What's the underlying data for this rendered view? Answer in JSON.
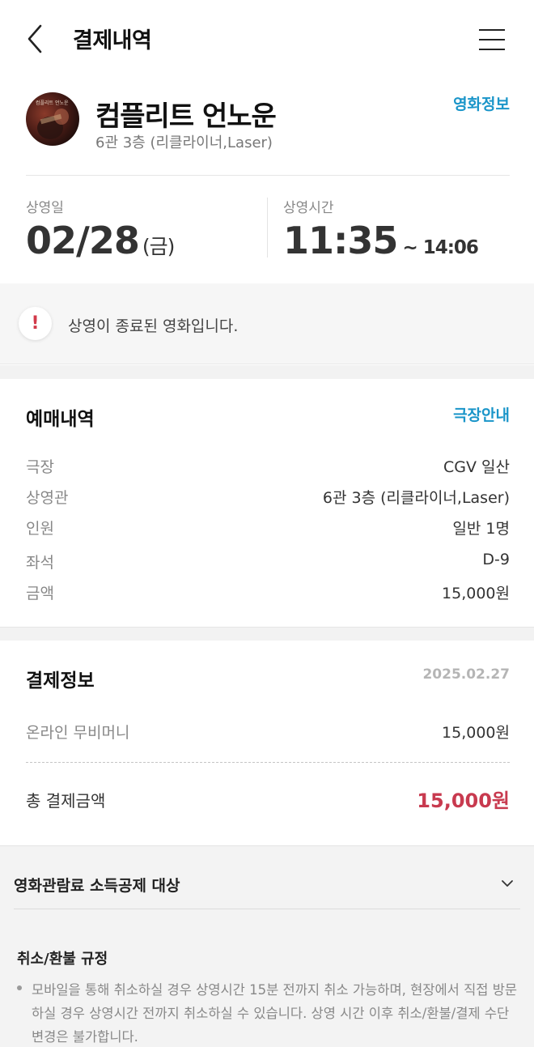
{
  "header": {
    "title": "결제내역"
  },
  "movie": {
    "title": "컴플리트 언노운",
    "screen": "6관 3층 (리클라이너,Laser)",
    "info_link": "영화정보",
    "poster_overlay": "컴플리트 언노운"
  },
  "schedule": {
    "date_label": "상영일",
    "date": "02/28",
    "day": "(금)",
    "time_label": "상영시간",
    "start": "11:35",
    "end": "~ 14:06"
  },
  "notice": {
    "icon": "!",
    "text": "상영이 종료된 영화입니다."
  },
  "booking": {
    "title": "예매내역",
    "link": "극장안내",
    "rows": [
      {
        "label": "극장",
        "value": "CGV 일산"
      },
      {
        "label": "상영관",
        "value": "6관 3층 (리클라이너,Laser)"
      },
      {
        "label": "인원",
        "value": "일반 1명"
      },
      {
        "label": "좌석",
        "value": "D-9"
      },
      {
        "label": "금액",
        "value": "15,000원"
      }
    ]
  },
  "payment": {
    "title": "결제정보",
    "date": "2025.02.27",
    "method_label": "온라인 무비머니",
    "method_value": "15,000원",
    "total_label": "총 결제금액",
    "total_value": "15,000원"
  },
  "deduction": {
    "label": "영화관람료 소득공제 대상"
  },
  "refund": {
    "title": "취소/환불 규정",
    "text": "모바일을 통해 취소하실 경우 상영시간 15분 전까지 취소 가능하며, 현장에서 직접 방문하실 경우 상영시간 전까지 취소하실 수 있습니다. 상영 시간 이후 취소/환불/결제 수단 변경은 불가합니다."
  },
  "colors": {
    "accent": "#1a95c9",
    "total": "#c83a4f",
    "alert": "#d23a4a"
  }
}
